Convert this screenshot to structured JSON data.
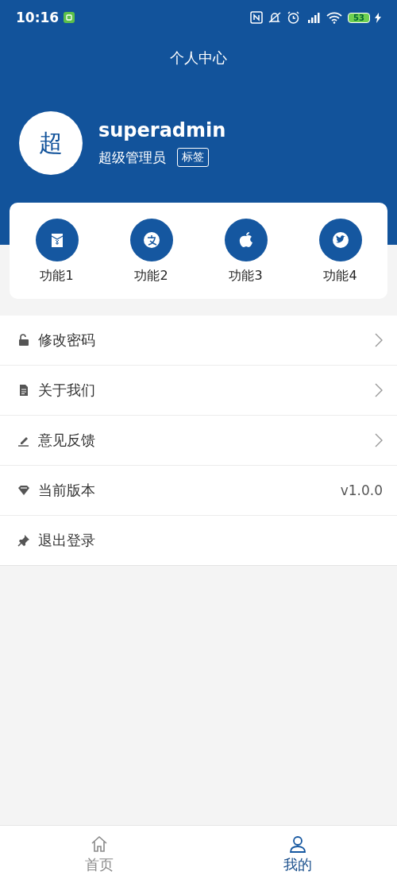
{
  "status_bar": {
    "time": "10:16",
    "battery": "53"
  },
  "header": {
    "title": "个人中心"
  },
  "profile": {
    "avatar": "超",
    "name": "superadmin",
    "role": "超级管理员",
    "tag": "标签"
  },
  "functions": [
    {
      "label": "功能1"
    },
    {
      "label": "功能2"
    },
    {
      "label": "功能3"
    },
    {
      "label": "功能4"
    }
  ],
  "menu": [
    {
      "kind": "link",
      "label": "修改密码"
    },
    {
      "kind": "link",
      "label": "关于我们"
    },
    {
      "kind": "link",
      "label": "意见反馈"
    },
    {
      "kind": "value",
      "label": "当前版本",
      "value": "v1.0.0"
    },
    {
      "kind": "action",
      "label": "退出登录"
    }
  ],
  "tab_bar": [
    {
      "label": "首页",
      "selected": false
    },
    {
      "label": "我的",
      "selected": true
    }
  ]
}
